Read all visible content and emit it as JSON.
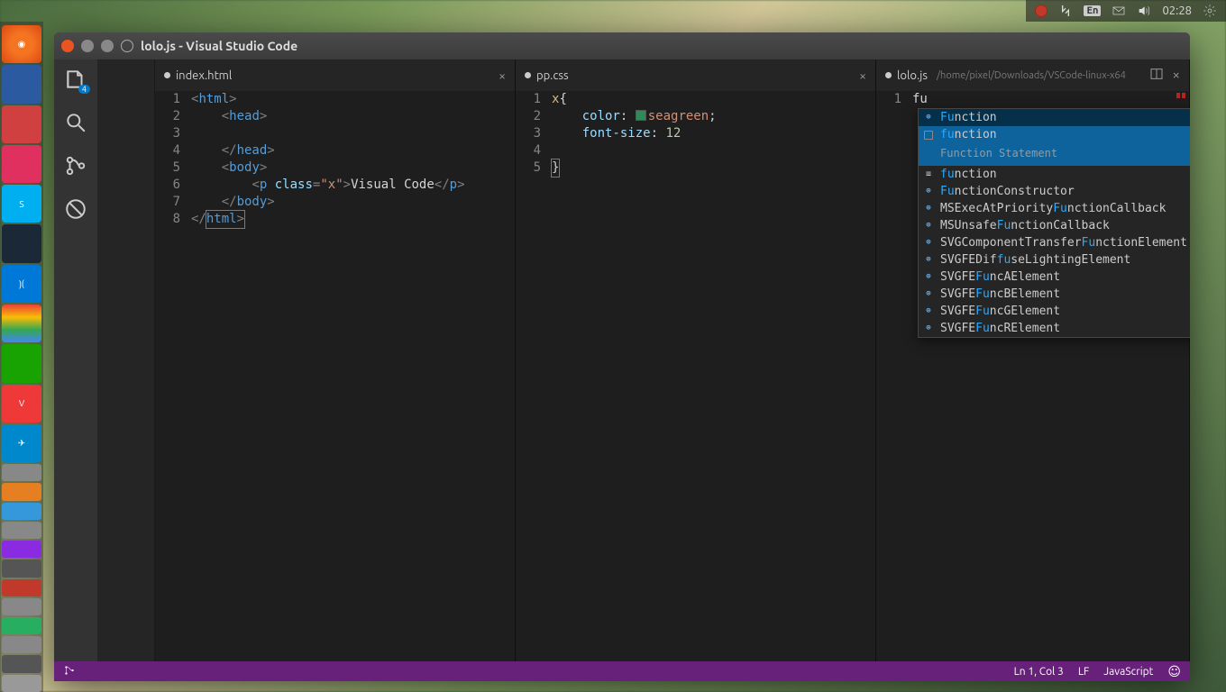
{
  "system_tray": {
    "lang": "En",
    "clock": "02:28"
  },
  "window": {
    "title": "lolo.js - Visual Studio Code"
  },
  "activity_bar": {
    "explorer_badge": "4"
  },
  "panes": [
    {
      "tab": "index.html",
      "modified": true,
      "lines": [
        "1",
        "2",
        "3",
        "4",
        "5",
        "6",
        "7",
        "8"
      ]
    },
    {
      "tab": "pp.css",
      "modified": true,
      "lines": [
        "1",
        "2",
        "3",
        "4",
        "5"
      ],
      "css": {
        "selector": "x",
        "prop1": "color",
        "val1": "seagreen",
        "prop2": "font-size",
        "val2": "12"
      }
    },
    {
      "tab": "lolo.js",
      "modified": true,
      "path": "/home/pixel/Downloads/VSCode-linux-x64",
      "lines": [
        "1"
      ],
      "typed": "fu"
    }
  ],
  "html_code": {
    "html": "html",
    "head": "head",
    "body": "body",
    "p": "p",
    "class_attr": "class",
    "class_val": "\"x\"",
    "text": "Visual Code"
  },
  "suggestions": {
    "selected_detail": "Function Statement",
    "items": [
      {
        "icon": "var",
        "pre": "Fu",
        "rest": "nction"
      },
      {
        "icon": "snip",
        "pre": "fu",
        "rest": "nction",
        "selected": true
      },
      {
        "icon": "kw",
        "pre": "fu",
        "rest": "nction"
      },
      {
        "icon": "var",
        "pre": "Fu",
        "rest": "nctionConstructor"
      },
      {
        "icon": "var",
        "before": "MSExecAtPriority",
        "pre": "Fu",
        "rest": "nctionCallback"
      },
      {
        "icon": "var",
        "before": "MSUnsafe",
        "pre": "Fu",
        "rest": "nctionCallback"
      },
      {
        "icon": "var",
        "before": "SVGComponentTransfer",
        "pre": "Fu",
        "rest": "nctionElement"
      },
      {
        "icon": "var",
        "before": "SVGFEDif",
        "pre": "fu",
        "rest": "seLightingElement"
      },
      {
        "icon": "var",
        "before": "SVGFE",
        "pre": "Fu",
        "rest": "ncAElement"
      },
      {
        "icon": "var",
        "before": "SVGFE",
        "pre": "Fu",
        "rest": "ncBElement"
      },
      {
        "icon": "var",
        "before": "SVGFE",
        "pre": "Fu",
        "rest": "ncGElement"
      },
      {
        "icon": "var",
        "before": "SVGFE",
        "pre": "Fu",
        "rest": "ncRElement"
      }
    ]
  },
  "statusbar": {
    "position": "Ln 1, Col 3",
    "eol": "LF",
    "lang": "JavaScript"
  }
}
